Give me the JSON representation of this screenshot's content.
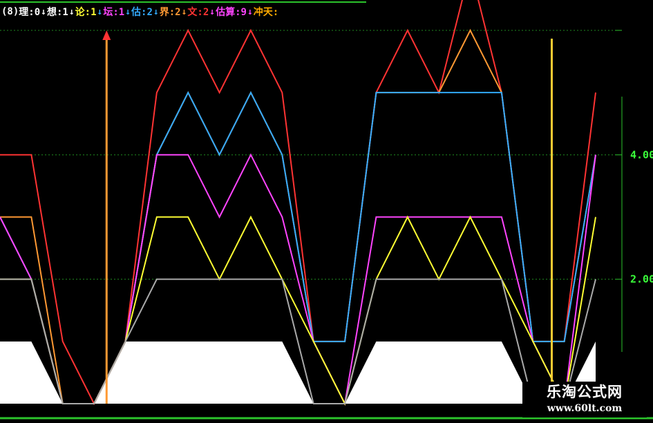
{
  "legend": {
    "prefix": "(8)",
    "items": [
      {
        "label": "理:0",
        "color": "#ffffff",
        "arrow": "↓",
        "arrow_color": "#ffffff"
      },
      {
        "label": "想:1",
        "color": "#ffffff",
        "arrow": "↓",
        "arrow_color": "#ffffff"
      },
      {
        "label": "论:1",
        "color": "#ffff33",
        "arrow": "↓",
        "arrow_color": "#33aaff"
      },
      {
        "label": "坛:1",
        "color": "#ff44ff",
        "arrow": "↓",
        "arrow_color": "#33aaff"
      },
      {
        "label": "估:2",
        "color": "#33aaff",
        "arrow": "↓",
        "arrow_color": "#33aaff"
      },
      {
        "label": "界:2",
        "color": "#ff9933",
        "arrow": "↓",
        "arrow_color": "#ff9933"
      },
      {
        "label": "文:2",
        "color": "#ff3333",
        "arrow": "↓",
        "arrow_color": "#ff44ff"
      },
      {
        "label": "估算:9",
        "color": "#ff44ff",
        "arrow": "↓",
        "arrow_color": "#ff44ff"
      },
      {
        "label": "冲天:",
        "color": "#ffaa00",
        "arrow": "",
        "arrow_color": "#ffaa00"
      }
    ]
  },
  "watermark": {
    "name": "乐淘公式网",
    "url": "www.60lt.com"
  },
  "colors": {
    "background": "#000000",
    "grid": "#1f8a1f",
    "axis": "#2bc42b",
    "tick_label": "#3aff3a",
    "fill": "#ffffff"
  },
  "chart_data": {
    "type": "line",
    "ylim": [
      0,
      6
    ],
    "grid": true,
    "y_ticks": [
      {
        "value": 2,
        "label": "2.00",
        "labeled": true
      },
      {
        "value": 4,
        "label": "4.00",
        "labeled": true
      },
      {
        "value": 6,
        "label": "",
        "labeled": false
      }
    ],
    "baseline": 0,
    "x": [
      0,
      5,
      10,
      15,
      20,
      25,
      30,
      35,
      40,
      45,
      50,
      55,
      60,
      65,
      70,
      75,
      80,
      85,
      90,
      95
    ],
    "series": [
      {
        "color": "#ff3333",
        "values": [
          4,
          4,
          1,
          0,
          1,
          5,
          6,
          5,
          6,
          5,
          1,
          1,
          5,
          6,
          5,
          7,
          5,
          1,
          1,
          5
        ]
      },
      {
        "color": "#ff9933",
        "values": [
          3,
          3,
          0,
          0,
          1,
          4,
          5,
          4,
          5,
          4,
          1,
          1,
          5,
          5,
          5,
          6,
          5,
          1,
          1,
          4
        ]
      },
      {
        "color": "#33aaff",
        "values": [
          3,
          2,
          0,
          0,
          1,
          4,
          5,
          4,
          5,
          4,
          1,
          1,
          5,
          5,
          5,
          5,
          5,
          1,
          1,
          4
        ]
      },
      {
        "color": "#ff44ff",
        "values": [
          3,
          2,
          0,
          0,
          1,
          4,
          4,
          3,
          4,
          3,
          1,
          0,
          3,
          3,
          3,
          3,
          3,
          1,
          0,
          4
        ]
      },
      {
        "color": "#ffff33",
        "values": [
          2,
          2,
          0,
          0,
          1,
          3,
          3,
          2,
          3,
          2,
          1,
          0,
          2,
          3,
          2,
          3,
          2,
          1,
          0,
          3
        ]
      },
      {
        "color": "#aaaaaa",
        "values": [
          2,
          2,
          0,
          0,
          1,
          2,
          2,
          2,
          2,
          2,
          0,
          0,
          2,
          2,
          2,
          2,
          2,
          0,
          0,
          2
        ]
      }
    ],
    "fill_series": {
      "color": "#ffffff",
      "values": [
        1,
        1,
        0,
        0,
        1,
        1,
        1,
        1,
        1,
        1,
        0,
        0,
        1,
        1,
        1,
        1,
        1,
        0,
        0,
        1
      ]
    },
    "signals": [
      {
        "x": 17,
        "color": "#ff9933",
        "arrow_color": "#ff3333"
      },
      {
        "x": 88,
        "color": "#ffcc33"
      }
    ]
  }
}
